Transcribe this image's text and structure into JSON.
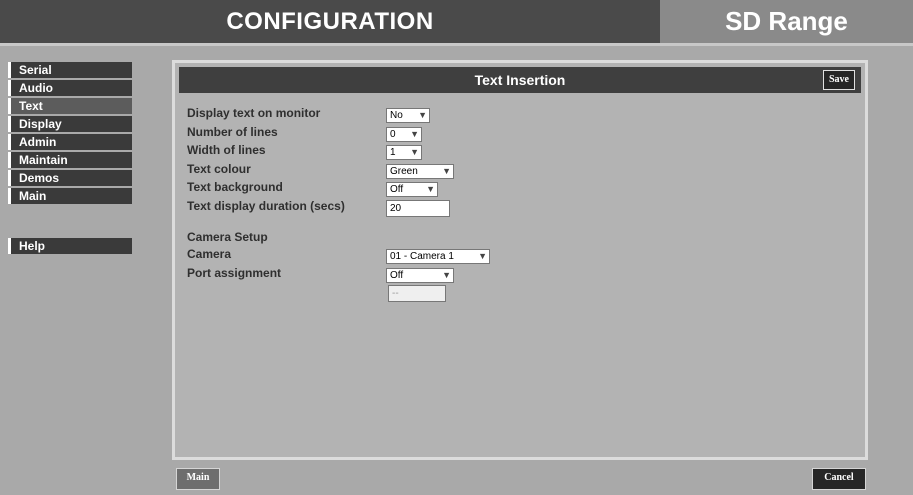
{
  "header": {
    "title": "CONFIGURATION",
    "brand": "SD Range"
  },
  "sidebar": {
    "items": [
      "Serial",
      "Audio",
      "Text",
      "Display",
      "Admin",
      "Maintain",
      "Demos",
      "Main"
    ],
    "active": "Text",
    "help": "Help"
  },
  "panel": {
    "title": "Text Insertion",
    "save_label": "Save",
    "fields": {
      "display_text": {
        "label": "Display text on monitor",
        "value": "No"
      },
      "num_lines": {
        "label": "Number of lines",
        "value": "0"
      },
      "width_lines": {
        "label": "Width of lines",
        "value": "1"
      },
      "text_colour": {
        "label": "Text colour",
        "value": "Green"
      },
      "text_background": {
        "label": "Text background",
        "value": "Off"
      },
      "duration": {
        "label": "Text display duration (secs)",
        "value": "20"
      }
    },
    "camera_setup": {
      "heading": "Camera Setup",
      "camera": {
        "label": "Camera",
        "value": "01 - Camera 1"
      },
      "port": {
        "label": "Port assignment",
        "value": "Off",
        "extra": "--"
      }
    }
  },
  "footer": {
    "main_label": "Main",
    "cancel_label": "Cancel"
  },
  "colors": {
    "header_bg": "#4a4a4a",
    "brand_bg": "#8a8a8a",
    "page_bg": "#a9a9a9",
    "panel_head_bg": "#3f3f3f"
  }
}
